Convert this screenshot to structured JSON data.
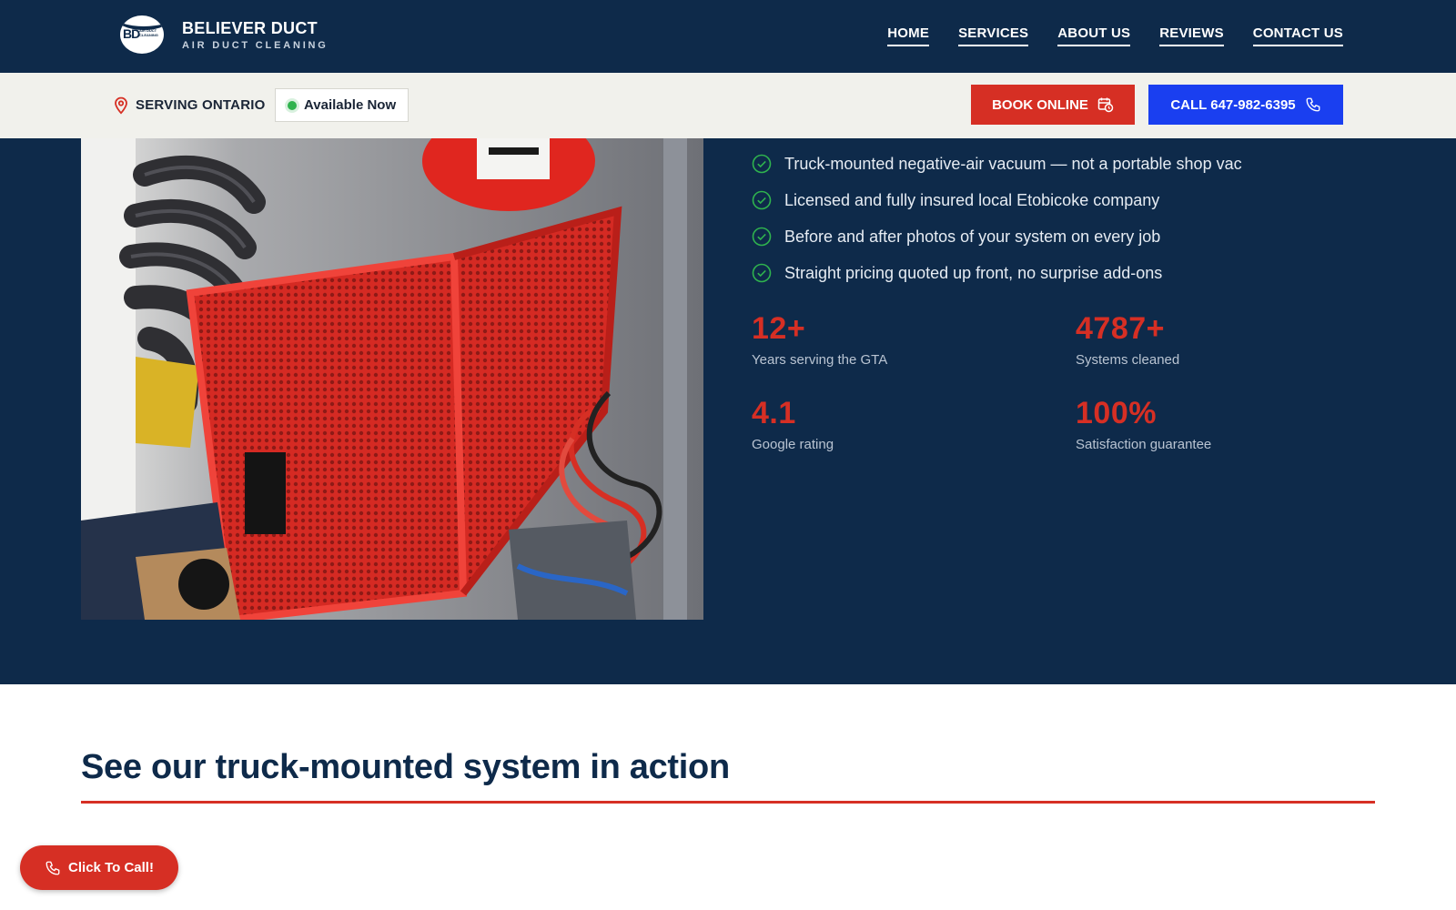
{
  "header": {
    "logo": {
      "badge": "BD",
      "badge_small": "AIR DUCT CLEANING",
      "name": "BELIEVER DUCT",
      "tagline": "AIR DUCT CLEANING"
    },
    "nav": [
      "HOME",
      "SERVICES",
      "ABOUT US",
      "REVIEWS",
      "CONTACT US"
    ]
  },
  "subbar": {
    "serving": "SERVING ONTARIO",
    "availability": "Available Now",
    "book_label": "BOOK ONLINE",
    "call_label": "CALL 647-982-6395"
  },
  "hero": {
    "checklist": [
      "Truck-mounted negative-air vacuum — not a portable shop vac",
      "Licensed and fully insured local Etobicoke company",
      "Before and after photos of your system on every job",
      "Straight pricing quoted up front, no surprise add-ons"
    ],
    "stats": [
      {
        "value": "12+",
        "label": "Years serving the GTA"
      },
      {
        "value": "4787+",
        "label": "Systems cleaned"
      },
      {
        "value": "4.1",
        "label": "Google rating"
      },
      {
        "value": "100%",
        "label": "Satisfaction guarantee"
      }
    ]
  },
  "section": {
    "title": "See our truck-mounted system in action"
  },
  "floating": {
    "call_label": "Click To Call!"
  },
  "colors": {
    "navy": "#0e2a4a",
    "red": "#d62f24",
    "blue": "#1a3ff0",
    "green": "#2fb34e",
    "cream": "#f1f1ec"
  },
  "icons": [
    "location-pin-icon",
    "status-dot-icon",
    "calendar-clock-icon",
    "phone-icon",
    "check-circle-icon"
  ]
}
